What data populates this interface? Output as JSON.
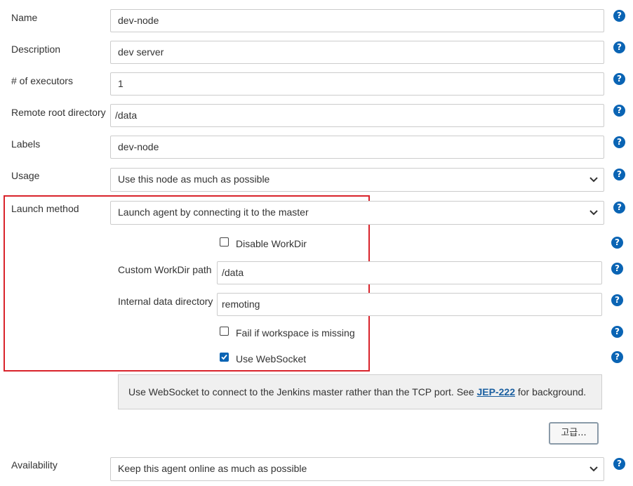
{
  "form": {
    "name": {
      "label": "Name",
      "value": "dev-node"
    },
    "description": {
      "label": "Description",
      "value": "dev server"
    },
    "executors": {
      "label": "# of executors",
      "value": "1"
    },
    "remote_root": {
      "label": "Remote root directory",
      "value": "/data"
    },
    "labels": {
      "label": "Labels",
      "value": "dev-node"
    },
    "usage": {
      "label": "Usage",
      "value": "Use this node as much as possible"
    },
    "launch_method": {
      "label": "Launch method",
      "value": "Launch agent by connecting it to the master"
    },
    "availability": {
      "label": "Availability",
      "value": "Keep this agent online as much as possible"
    }
  },
  "launch": {
    "disable_workdir": {
      "label": "Disable WorkDir",
      "checked": false
    },
    "custom_workdir": {
      "label": "Custom WorkDir path",
      "value": "/data"
    },
    "internal_data_dir": {
      "label": "Internal data directory",
      "value": "remoting"
    },
    "fail_if_missing": {
      "label": "Fail if workspace is missing",
      "checked": false
    },
    "use_websocket": {
      "label": "Use WebSocket",
      "checked": true
    }
  },
  "websocket_info": {
    "text_before": "Use WebSocket to connect to the Jenkins master rather than the TCP port. See ",
    "link": "JEP-222",
    "text_after": " for background."
  },
  "advanced_button": "고급...",
  "help_glyph": "?",
  "colors": {
    "help": "#0a64b4",
    "highlight_border": "#d9232b",
    "link": "#1a5fa0"
  },
  "icons": {
    "help": "help-icon",
    "chevron": "chevron-down-icon",
    "check": "checkmark-icon"
  }
}
